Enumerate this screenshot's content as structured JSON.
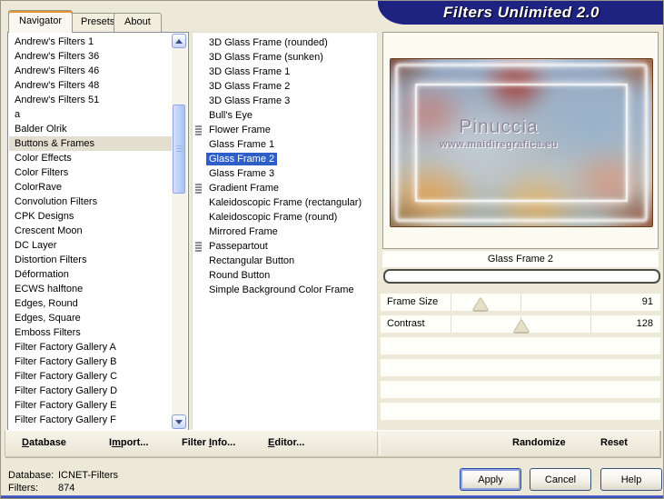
{
  "window": {
    "title": "Filters Unlimited 2.0"
  },
  "tabs": [
    {
      "label": "Navigator",
      "active": true
    },
    {
      "label": "Presets",
      "active": false
    },
    {
      "label": "About",
      "active": false
    }
  ],
  "category_list": {
    "selected_index": 7,
    "items": [
      "Andrew's Filters 1",
      "Andrew's Filters 36",
      "Andrew's Filters 46",
      "Andrew's Filters 48",
      "Andrew's Filters 51",
      "a",
      "Balder Olrik",
      "Buttons & Frames",
      "Color Effects",
      "Color Filters",
      "ColorRave",
      "Convolution Filters",
      "CPK Designs",
      "Crescent Moon",
      "DC Layer",
      "Distortion Filters",
      "Déformation",
      "ECWS halftone",
      "Edges, Round",
      "Edges, Square",
      "Emboss Filters",
      "Filter Factory Gallery A",
      "Filter Factory Gallery B",
      "Filter Factory Gallery C",
      "Filter Factory Gallery D",
      "Filter Factory Gallery E",
      "Filter Factory Gallery F"
    ]
  },
  "filter_list": {
    "items": [
      {
        "label": "3D Glass Frame (rounded)",
        "preset": false,
        "selected": false
      },
      {
        "label": "3D Glass Frame (sunken)",
        "preset": false,
        "selected": false
      },
      {
        "label": "3D Glass Frame 1",
        "preset": false,
        "selected": false
      },
      {
        "label": "3D Glass Frame 2",
        "preset": false,
        "selected": false
      },
      {
        "label": "3D Glass Frame 3",
        "preset": false,
        "selected": false
      },
      {
        "label": "Bull's Eye",
        "preset": false,
        "selected": false
      },
      {
        "label": "Flower Frame",
        "preset": true,
        "selected": false
      },
      {
        "label": "Glass Frame 1",
        "preset": false,
        "selected": false
      },
      {
        "label": "Glass Frame 2",
        "preset": false,
        "selected": true
      },
      {
        "label": "Glass Frame 3",
        "preset": false,
        "selected": false
      },
      {
        "label": "Gradient Frame",
        "preset": true,
        "selected": false
      },
      {
        "label": "Kaleidoscopic Frame (rectangular)",
        "preset": false,
        "selected": false
      },
      {
        "label": "Kaleidoscopic Frame (round)",
        "preset": false,
        "selected": false
      },
      {
        "label": "Mirrored Frame",
        "preset": false,
        "selected": false
      },
      {
        "label": "Passepartout",
        "preset": true,
        "selected": false
      },
      {
        "label": "Rectangular Button",
        "preset": false,
        "selected": false
      },
      {
        "label": "Round Button",
        "preset": false,
        "selected": false
      },
      {
        "label": "Simple Background Color Frame",
        "preset": false,
        "selected": false
      }
    ]
  },
  "preview": {
    "caption": "Glass Frame 2",
    "progress_value_percent": 0
  },
  "sliders": {
    "max": 255,
    "rows": [
      {
        "label": "Frame Size",
        "value": 91
      },
      {
        "label": "Contrast",
        "value": 128
      }
    ],
    "empty_rows": 4
  },
  "watermark": {
    "line1": "Pinuccia",
    "line2": "www.maidiregrafica.eu"
  },
  "toolbar": {
    "items": [
      {
        "id": "database",
        "pre": "",
        "key": "D",
        "post": "atabase"
      },
      {
        "id": "import",
        "pre": "I",
        "key": "m",
        "post": "port..."
      },
      {
        "id": "filter-info",
        "pre": "Filter ",
        "key": "I",
        "post": "nfo..."
      },
      {
        "id": "editor",
        "pre": "",
        "key": "E",
        "post": "ditor..."
      },
      {
        "id": "randomize",
        "pre": "Randomize",
        "key": "",
        "post": ""
      },
      {
        "id": "reset",
        "pre": "Reset",
        "key": "",
        "post": ""
      }
    ]
  },
  "status": {
    "database_label": "Database:",
    "database_value": "ICNET-Filters",
    "filters_label": "Filters:",
    "filters_value": "874"
  },
  "action_buttons": {
    "apply": "Apply",
    "cancel": "Cancel",
    "help": "Help"
  },
  "colors": {
    "banner_navy": "#1e2280",
    "selection_blue": "#2e5fc8",
    "tab_accent_orange": "#e8902c",
    "face_beige": "#ece9d8"
  }
}
